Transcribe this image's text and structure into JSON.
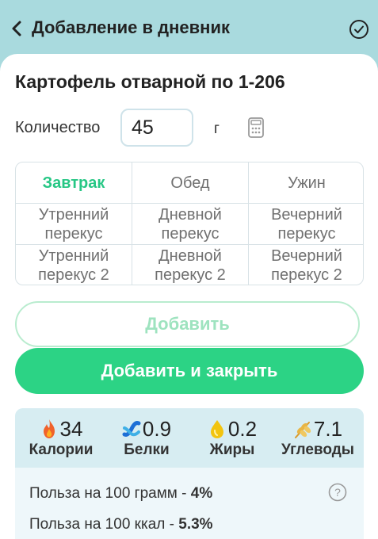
{
  "header": {
    "title": "Добавление в дневник",
    "back_icon": "chevron-left-icon",
    "confirm_icon": "check-circle-icon"
  },
  "product": {
    "title": "Картофель отварной по 1-206"
  },
  "quantity": {
    "label": "Количество",
    "value": "45",
    "unit": "г",
    "icon": "calculator-icon"
  },
  "meals": [
    {
      "label": "Завтрак",
      "active": true
    },
    {
      "label": "Обед",
      "active": false
    },
    {
      "label": "Ужин",
      "active": false
    },
    {
      "label": "Утренний\nперекус",
      "active": false
    },
    {
      "label": "Дневной\nперекус",
      "active": false
    },
    {
      "label": "Вечерний\nперекус",
      "active": false
    },
    {
      "label": "Утренний\nперекус 2",
      "active": false
    },
    {
      "label": "Дневной\nперекус 2",
      "active": false
    },
    {
      "label": "Вечерний\nперекус 2",
      "active": false
    }
  ],
  "buttons": {
    "add": "Добавить",
    "add_close": "Добавить и закрыть"
  },
  "nutrition": {
    "calories": {
      "value": "34",
      "label": "Калории",
      "icon": "fire-icon"
    },
    "protein": {
      "value": "0.9",
      "label": "Белки",
      "icon": "protein-icon"
    },
    "fat": {
      "value": "0.2",
      "label": "Жиры",
      "icon": "oil-drop-icon"
    },
    "carbs": {
      "value": "7.1",
      "label": "Углеводы",
      "icon": "wheat-icon"
    }
  },
  "benefit": {
    "per100g_label": "Польза на 100 грамм - ",
    "per100g_value": "4%",
    "per100kcal_label": "Польза на 100 ккал - ",
    "per100kcal_value": "5.3%",
    "help_icon": "question-circle-icon"
  },
  "colors": {
    "accent": "#2cd385",
    "active_text": "#27c785",
    "header_bg": "#a9dade",
    "panel_bg": "#eef7fa"
  }
}
